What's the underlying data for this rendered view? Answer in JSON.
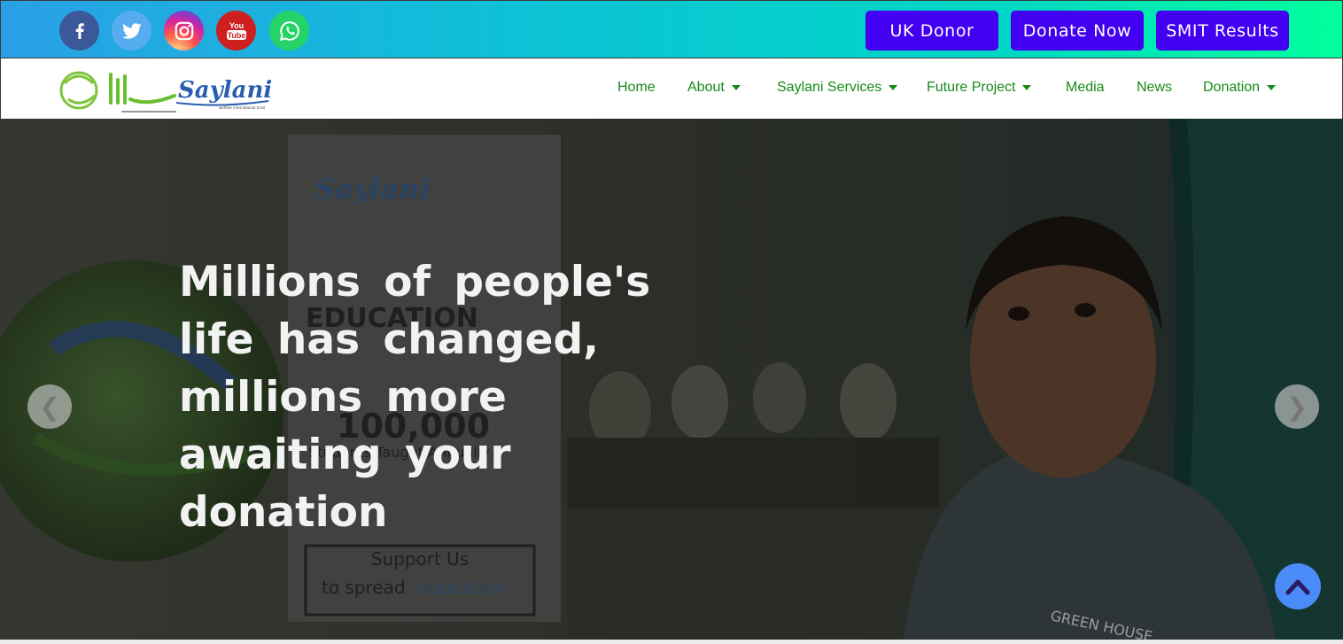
{
  "topbar": {
    "social": [
      {
        "name": "facebook",
        "icon": "facebook-icon",
        "color": "#3b5998"
      },
      {
        "name": "twitter",
        "icon": "twitter-icon",
        "color": "#55acee"
      },
      {
        "name": "instagram",
        "icon": "instagram-icon",
        "color": "#d6249f"
      },
      {
        "name": "youtube",
        "icon": "youtube-icon",
        "color": "#cd201f"
      },
      {
        "name": "whatsapp",
        "icon": "whatsapp-icon",
        "color": "#25d366"
      }
    ],
    "youtube_text": "You Tube",
    "buttons": {
      "uk_donor": "UK Donor",
      "donate_now": "Donate Now",
      "smit_results": "SMIT Results"
    },
    "button_color": "#4300f0"
  },
  "logo": {
    "text": "Saylani",
    "tagline": "welfare international trust"
  },
  "nav": {
    "home": "Home",
    "about": "About",
    "services": "Saylani Services",
    "future": "Future Project",
    "media": "Media",
    "news": "News",
    "donation": "Donation",
    "link_color": "#178a17"
  },
  "hero": {
    "heading": "Millions of people's life has changed, millions more awaiting your donation",
    "poster": {
      "logo_text": "Saylani",
      "program": "EDUCATION",
      "stat": "100,000",
      "stat_caption": "Students Taught Annually",
      "cta_line1": "Support Us",
      "cta_line2_prefix": "to spread",
      "cta_line2_highlight": "education"
    },
    "shirt_text": "GREEN HOUSE"
  },
  "controls": {
    "prev": "❮",
    "next": "❯",
    "scroll_top_icon": "chevron-up-icon"
  }
}
